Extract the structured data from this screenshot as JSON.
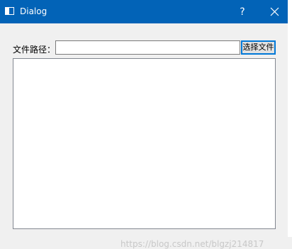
{
  "window": {
    "title": "Dialog",
    "help_glyph": "?"
  },
  "form": {
    "path_label": "文件路径：",
    "path_value": "",
    "choose_button_label": "选择文件",
    "text_content": ""
  },
  "watermark": "https://blog.csdn.net/blgzj214817",
  "colors": {
    "titlebar": "#0263b7",
    "client_bg": "#f0f0f0",
    "focus_border": "#0078d7"
  }
}
